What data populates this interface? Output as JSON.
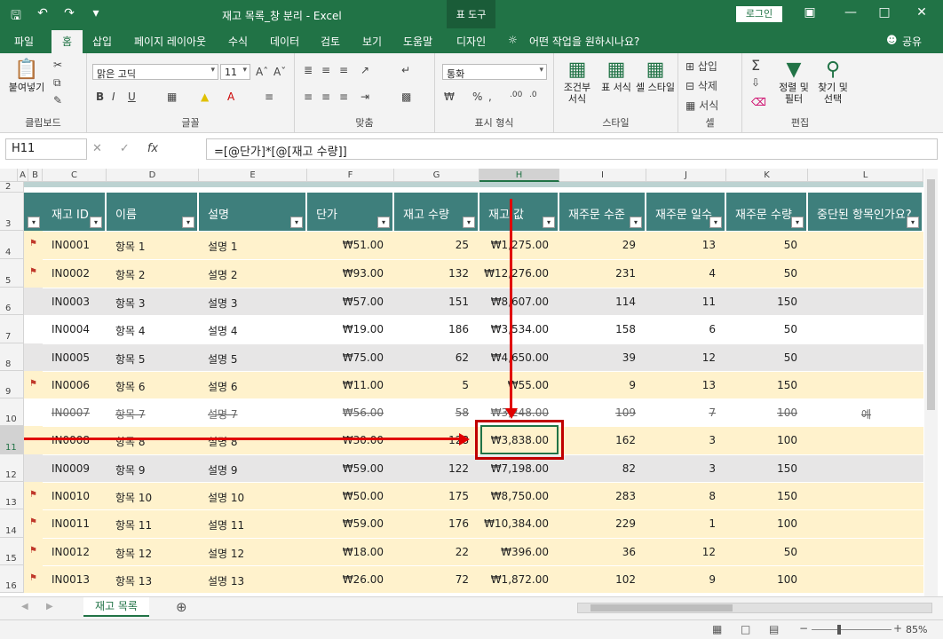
{
  "window": {
    "title": "재고 목록_창 분리  -  Excel",
    "context_tab": "표 도구",
    "login_label": "로그인"
  },
  "ribbon_tabs": [
    "파일",
    "홈",
    "삽입",
    "페이지 레이아웃",
    "수식",
    "데이터",
    "검토",
    "보기",
    "도움말",
    "디자인"
  ],
  "tell_me": "어떤 작업을 원하시나요?",
  "share_label": "공유",
  "ribbon": {
    "clipboard": {
      "paste": "붙여넣기",
      "label": "클립보드"
    },
    "font": {
      "name": "맑은 고딕",
      "size": "11",
      "label": "글꼴"
    },
    "align": {
      "label": "맞춤"
    },
    "number": {
      "format": "통화",
      "label": "표시 형식"
    },
    "styles": {
      "cond": "조건부 서식",
      "table": "표 서식",
      "cell": "셀 스타일",
      "label": "스타일"
    },
    "cells": {
      "insert": "삽입",
      "delete": "삭제",
      "format": "서식",
      "label": "셀"
    },
    "editing": {
      "sort": "정렬 및 필터",
      "find": "찾기 및 선택",
      "label": "편집"
    }
  },
  "formula_bar": {
    "name_box": "H11",
    "formula": "=[@단가]*[@[재고 수량]]"
  },
  "columns": [
    "A",
    "B",
    "C",
    "D",
    "E",
    "F",
    "G",
    "H",
    "I",
    "J",
    "K",
    "L"
  ],
  "row_numbers": [
    "2",
    "3",
    "4",
    "5",
    "6",
    "7",
    "8",
    "9",
    "10",
    "11",
    "12",
    "13",
    "14",
    "15",
    "16"
  ],
  "table": {
    "headers": [
      "재고 ID",
      "이름",
      "설명",
      "단가",
      "재고 수량",
      "재고 값",
      "재주문 수준",
      "재주문 일수",
      "재주문 수량",
      "중단된 항목인가요?"
    ],
    "rows": [
      {
        "flag": true,
        "id": "IN0001",
        "name": "항목 1",
        "desc": "설명 1",
        "price": "₩51.00",
        "qty": "25",
        "value": "₩1,275.00",
        "level": "29",
        "days": "13",
        "reorder": "50",
        "disc": "",
        "style": "yellow"
      },
      {
        "flag": true,
        "id": "IN0002",
        "name": "항목 2",
        "desc": "설명 2",
        "price": "₩93.00",
        "qty": "132",
        "value": "₩12,276.00",
        "level": "231",
        "days": "4",
        "reorder": "50",
        "disc": "",
        "style": "yellow"
      },
      {
        "flag": false,
        "id": "IN0003",
        "name": "항목 3",
        "desc": "설명 3",
        "price": "₩57.00",
        "qty": "151",
        "value": "₩8,607.00",
        "level": "114",
        "days": "11",
        "reorder": "150",
        "disc": "",
        "style": "gray"
      },
      {
        "flag": false,
        "id": "IN0004",
        "name": "항목 4",
        "desc": "설명 4",
        "price": "₩19.00",
        "qty": "186",
        "value": "₩3,534.00",
        "level": "158",
        "days": "6",
        "reorder": "50",
        "disc": "",
        "style": "white"
      },
      {
        "flag": false,
        "id": "IN0005",
        "name": "항목 5",
        "desc": "설명 5",
        "price": "₩75.00",
        "qty": "62",
        "value": "₩4,650.00",
        "level": "39",
        "days": "12",
        "reorder": "50",
        "disc": "",
        "style": "gray"
      },
      {
        "flag": true,
        "id": "IN0006",
        "name": "항목 6",
        "desc": "설명 6",
        "price": "₩11.00",
        "qty": "5",
        "value": "₩55.00",
        "level": "9",
        "days": "13",
        "reorder": "150",
        "disc": "",
        "style": "yellow"
      },
      {
        "flag": false,
        "id": "IN0007",
        "name": "항목 7",
        "desc": "설명 7",
        "price": "₩56.00",
        "qty": "58",
        "value": "₩3,248.00",
        "level": "109",
        "days": "7",
        "reorder": "100",
        "disc": "예",
        "style": "white",
        "strike": true
      },
      {
        "flag": false,
        "id": "IN0008",
        "name": "항목 8",
        "desc": "설명 8",
        "price": "₩30.00",
        "qty": "128",
        "value": "₩3,838.00",
        "level": "162",
        "days": "3",
        "reorder": "100",
        "disc": "",
        "style": "yellow"
      },
      {
        "flag": false,
        "id": "IN0009",
        "name": "항목 9",
        "desc": "설명 9",
        "price": "₩59.00",
        "qty": "122",
        "value": "₩7,198.00",
        "level": "82",
        "days": "3",
        "reorder": "150",
        "disc": "",
        "style": "gray"
      },
      {
        "flag": true,
        "id": "IN0010",
        "name": "항목 10",
        "desc": "설명 10",
        "price": "₩50.00",
        "qty": "175",
        "value": "₩8,750.00",
        "level": "283",
        "days": "8",
        "reorder": "150",
        "disc": "",
        "style": "yellow"
      },
      {
        "flag": true,
        "id": "IN0011",
        "name": "항목 11",
        "desc": "설명 11",
        "price": "₩59.00",
        "qty": "176",
        "value": "₩10,384.00",
        "level": "229",
        "days": "1",
        "reorder": "100",
        "disc": "",
        "style": "yellow"
      },
      {
        "flag": true,
        "id": "IN0012",
        "name": "항목 12",
        "desc": "설명 12",
        "price": "₩18.00",
        "qty": "22",
        "value": "₩396.00",
        "level": "36",
        "days": "12",
        "reorder": "50",
        "disc": "",
        "style": "yellow"
      },
      {
        "flag": true,
        "id": "IN0013",
        "name": "항목 13",
        "desc": "설명 13",
        "price": "₩26.00",
        "qty": "72",
        "value": "₩1,872.00",
        "level": "102",
        "days": "9",
        "reorder": "100",
        "disc": "",
        "style": "yellow"
      }
    ]
  },
  "sheet_tab": "재고 목록",
  "status": {
    "zoom": "85%"
  }
}
